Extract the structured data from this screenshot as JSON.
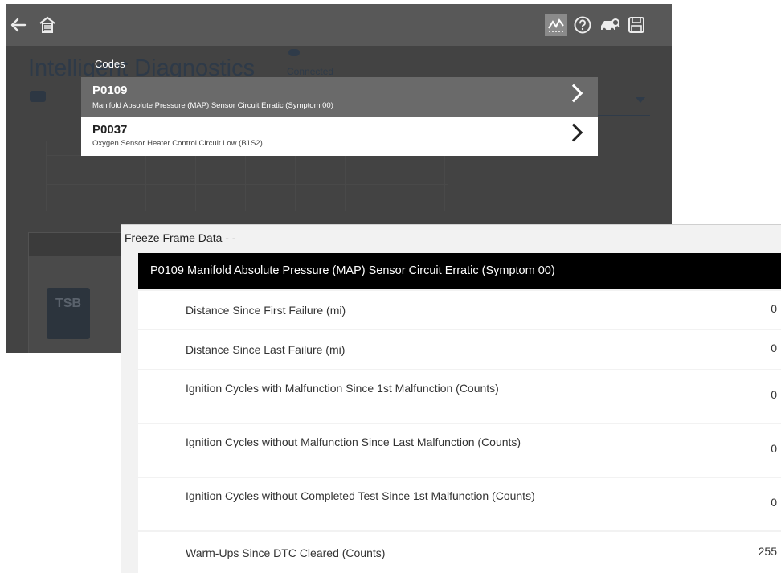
{
  "app": {
    "title": "Intelligent Diagnostics",
    "connection_status": "Connected",
    "tsb_badge": "TSB"
  },
  "codes_popup": {
    "label": "Codes",
    "items": [
      {
        "code": "P0109",
        "description": "Manifold Absolute Pressure (MAP) Sensor Circuit Erratic (Symptom 00)",
        "selected": true
      },
      {
        "code": "P0037",
        "description": "Oxygen Sensor Heater Control Circuit Low (B1S2)",
        "selected": false
      }
    ]
  },
  "freeze_frame": {
    "title": "Freeze Frame Data - -",
    "header": "P0109 Manifold Absolute Pressure (MAP) Sensor Circuit Erratic (Symptom 00)",
    "rows": [
      {
        "label": "Distance Since First Failure (mi)",
        "value": "0"
      },
      {
        "label": "Distance Since Last Failure (mi)",
        "value": "0"
      },
      {
        "label": "Ignition Cycles with Malfunction Since 1st Malfunction (Counts)",
        "value": "0"
      },
      {
        "label": "Ignition Cycles without Malfunction Since Last Malfunction (Counts)",
        "value": "0"
      },
      {
        "label": "Ignition Cycles without Completed Test Since 1st Malfunction (Counts)",
        "value": "0"
      },
      {
        "label": "Warm-Ups Since DTC Cleared (Counts)",
        "value": "255"
      }
    ]
  },
  "icons": {
    "toolbar": [
      "back-arrow-icon",
      "home-icon",
      "data-graph-icon",
      "help-icon",
      "vehicle-scan-icon",
      "save-icon"
    ]
  },
  "colors": {
    "toolbar_bg": "#585858",
    "selected_row_bg": "#6a6a6a",
    "header_bg": "#000000",
    "panel_bg": "#f2f2f2"
  }
}
